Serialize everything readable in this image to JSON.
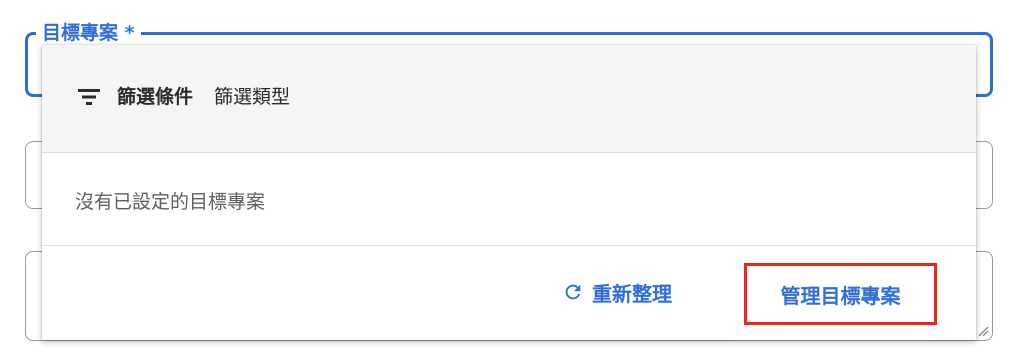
{
  "field": {
    "label": "目標專案 *"
  },
  "dropdown": {
    "filter_icon": "filter-list-icon",
    "filter_label": "篩選條件",
    "filter_type": "篩選類型",
    "empty_message": "沒有已設定的目標專案",
    "refresh_icon": "refresh-icon",
    "refresh_label": "重新整理",
    "manage_label": "管理目標專案"
  },
  "colors": {
    "accent": "#2f6ed8",
    "highlight_border": "#e8281c",
    "filter_bar_bg": "#f5f5f5"
  }
}
